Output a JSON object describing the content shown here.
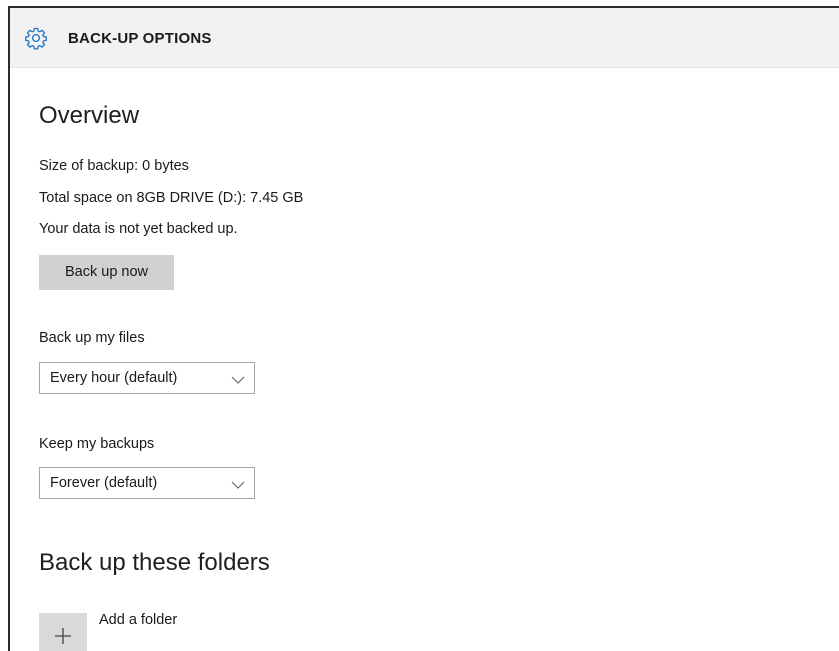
{
  "header": {
    "title": "BACK-UP OPTIONS",
    "icon": "gear-icon",
    "accent_color": "#1a73c8"
  },
  "overview": {
    "heading": "Overview",
    "size_line": "Size of backup: 0 bytes",
    "space_line": "Total space on 8GB DRIVE (D:): 7.45 GB",
    "status_line": "Your data is not yet backed up.",
    "backup_now_label": "Back up now"
  },
  "frequency": {
    "label": "Back up my files",
    "selected": "Every hour (default)"
  },
  "retention": {
    "label": "Keep my backups",
    "selected": "Forever (default)"
  },
  "folders": {
    "heading": "Back up these folders",
    "add_label": "Add a folder",
    "add_icon": "plus-icon"
  }
}
